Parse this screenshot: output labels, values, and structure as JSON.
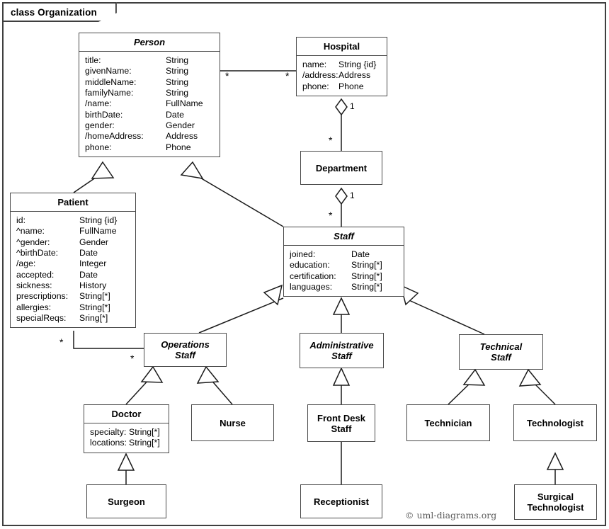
{
  "frame": {
    "label": "class Organization"
  },
  "credit": "© uml-diagrams.org",
  "classes": {
    "person": {
      "name": "Person",
      "attrs": [
        {
          "key": "title:",
          "value": "String"
        },
        {
          "key": "givenName:",
          "value": "String"
        },
        {
          "key": "middleName:",
          "value": "String"
        },
        {
          "key": "familyName:",
          "value": "String"
        },
        {
          "key": "/name:",
          "value": "FullName"
        },
        {
          "key": "birthDate:",
          "value": "Date"
        },
        {
          "key": "gender:",
          "value": "Gender"
        },
        {
          "key": "/homeAddress:",
          "value": "Address"
        },
        {
          "key": "phone:",
          "value": "Phone"
        }
      ]
    },
    "hospital": {
      "name": "Hospital",
      "attrs": [
        {
          "key": "name:",
          "value": "String {id}"
        },
        {
          "key": "/address:",
          "value": "Address"
        },
        {
          "key": "phone:",
          "value": "Phone"
        }
      ]
    },
    "department": {
      "name": "Department"
    },
    "patient": {
      "name": "Patient",
      "attrs": [
        {
          "key": "id:",
          "value": "String {id}"
        },
        {
          "key": "^name:",
          "value": "FullName"
        },
        {
          "key": "^gender:",
          "value": "Gender"
        },
        {
          "key": "^birthDate:",
          "value": "Date"
        },
        {
          "key": "/age:",
          "value": "Integer"
        },
        {
          "key": "accepted:",
          "value": "Date"
        },
        {
          "key": "sickness:",
          "value": "History"
        },
        {
          "key": "prescriptions:",
          "value": "String[*]"
        },
        {
          "key": "allergies:",
          "value": "String[*]"
        },
        {
          "key": "specialReqs:",
          "value": "Sring[*]"
        }
      ]
    },
    "staff": {
      "name": "Staff",
      "attrs": [
        {
          "key": "joined:",
          "value": "Date"
        },
        {
          "key": "education:",
          "value": "String[*]"
        },
        {
          "key": "certification:",
          "value": "String[*]"
        },
        {
          "key": "languages:",
          "value": "String[*]"
        }
      ]
    },
    "operations_staff": {
      "name": "Operations\nStaff"
    },
    "administrative_staff": {
      "name": "Administrative\nStaff"
    },
    "technical_staff": {
      "name": "Technical\nStaff"
    },
    "doctor": {
      "name": "Doctor",
      "attrs": [
        {
          "key": "specialty:",
          "value": "String[*]"
        },
        {
          "key": "locations:",
          "value": "String[*]"
        }
      ]
    },
    "nurse": {
      "name": "Nurse"
    },
    "front_desk_staff": {
      "name": "Front Desk\nStaff"
    },
    "technician": {
      "name": "Technician"
    },
    "technologist": {
      "name": "Technologist"
    },
    "surgeon": {
      "name": "Surgeon"
    },
    "receptionist": {
      "name": "Receptionist"
    },
    "surgical_technologist": {
      "name": "Surgical\nTechnologist"
    }
  },
  "multiplicities": {
    "person_hospital_person_end": "*",
    "person_hospital_hospital_end": "*",
    "hospital_department_hospital_end": "1",
    "hospital_department_department_end": "*",
    "department_staff_department_end": "1",
    "department_staff_staff_end": "*",
    "patient_opstaff_patient_end": "*",
    "patient_opstaff_opstaff_end": "*"
  },
  "relationships": [
    {
      "type": "association",
      "from": "Person",
      "to": "Hospital",
      "from_mult": "*",
      "to_mult": "*"
    },
    {
      "type": "composition",
      "whole": "Hospital",
      "part": "Department",
      "whole_mult": "1",
      "part_mult": "*"
    },
    {
      "type": "composition",
      "whole": "Department",
      "part": "Staff",
      "whole_mult": "1",
      "part_mult": "*"
    },
    {
      "type": "association",
      "from": "Patient",
      "to": "Operations Staff",
      "from_mult": "*",
      "to_mult": "*"
    },
    {
      "type": "generalization",
      "sub": "Patient",
      "super": "Person"
    },
    {
      "type": "generalization",
      "sub": "Staff",
      "super": "Person"
    },
    {
      "type": "generalization",
      "sub": "Operations Staff",
      "super": "Staff"
    },
    {
      "type": "generalization",
      "sub": "Administrative Staff",
      "super": "Staff"
    },
    {
      "type": "generalization",
      "sub": "Technical Staff",
      "super": "Staff"
    },
    {
      "type": "generalization",
      "sub": "Doctor",
      "super": "Operations Staff"
    },
    {
      "type": "generalization",
      "sub": "Nurse",
      "super": "Operations Staff"
    },
    {
      "type": "generalization",
      "sub": "Front Desk Staff",
      "super": "Administrative Staff"
    },
    {
      "type": "generalization",
      "sub": "Technician",
      "super": "Technical Staff"
    },
    {
      "type": "generalization",
      "sub": "Technologist",
      "super": "Technical Staff"
    },
    {
      "type": "generalization",
      "sub": "Surgeon",
      "super": "Doctor"
    },
    {
      "type": "generalization",
      "sub": "Receptionist",
      "super": "Front Desk Staff"
    },
    {
      "type": "generalization",
      "sub": "Surgical Technologist",
      "super": "Technologist"
    }
  ]
}
